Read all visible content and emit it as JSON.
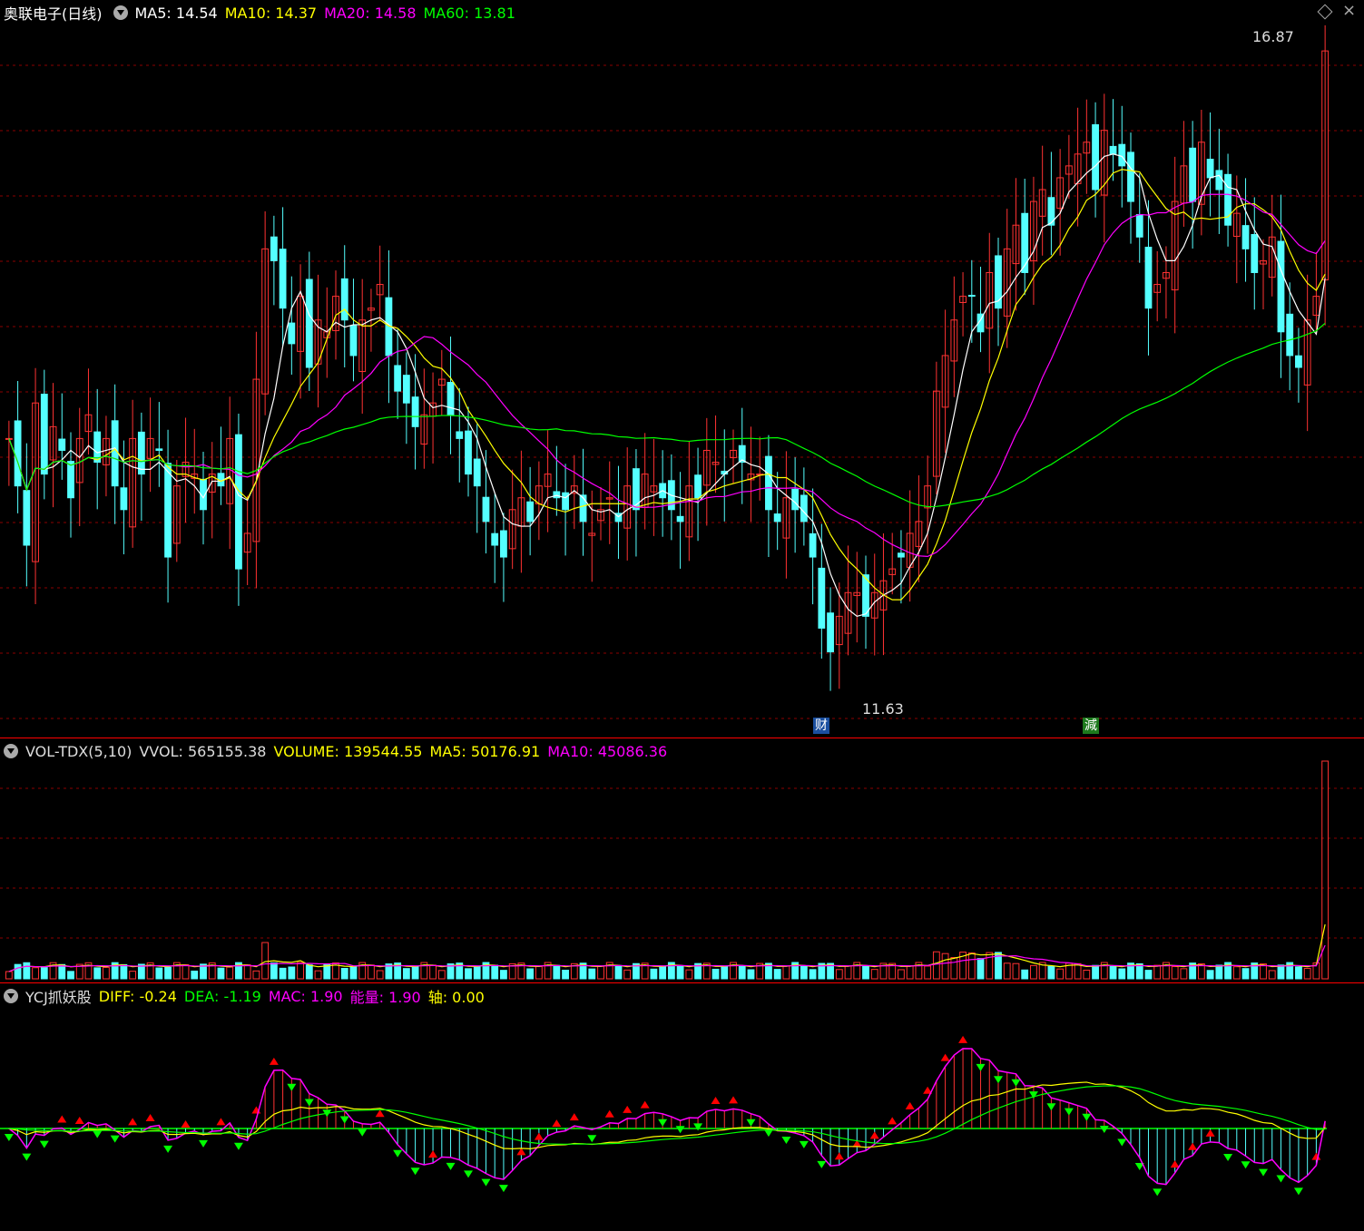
{
  "colors": {
    "up": "#ff3232",
    "down": "#54ffff",
    "ma5": "#ffffff",
    "ma10": "#ffff00",
    "ma20": "#ff00ff",
    "ma60": "#00ff00",
    "grid": "#8b0000",
    "axis": "#ff0000"
  },
  "price_panel": {
    "title": "奥联电子(日线)",
    "ma5": "MA5: 14.54",
    "ma10": "MA10: 14.37",
    "ma20": "MA20: 14.58",
    "ma60": "MA60: 13.81",
    "high_label": "16.87",
    "low_label": "11.63",
    "badge1": "财",
    "badge2": "減"
  },
  "vol_panel": {
    "name": "VOL-TDX(5,10)",
    "vvol": "VVOL: 565155.38",
    "volume": "VOLUME: 139544.55",
    "ma5": "MA5: 50176.91",
    "ma10": "MA10: 45086.36"
  },
  "ind_panel": {
    "name": "YCJ抓妖股",
    "diff": "DIFF: -0.24",
    "dea": "DEA: -1.19",
    "mac": "MAC: 1.90",
    "energy": "能量: 1.90",
    "axis": "轴: 0.00"
  },
  "chart_data": [
    {
      "type": "candlestick",
      "title": "奥联电子(日线)",
      "y_low": 11.63,
      "y_high": 16.87,
      "closes": [
        13.6,
        13.2,
        12.7,
        13.9,
        13.3,
        13.7,
        13.5,
        13.1,
        13.6,
        13.8,
        13.4,
        13.6,
        13.2,
        13.0,
        13.6,
        13.3,
        13.6,
        13.5,
        12.6,
        13.2,
        13.4,
        13.3,
        13.0,
        13.3,
        13.2,
        13.6,
        12.5,
        12.8,
        14.1,
        15.2,
        15.1,
        14.7,
        14.4,
        14.8,
        14.2,
        14.6,
        14.5,
        14.8,
        14.6,
        14.3,
        14.6,
        14.7,
        14.9,
        14.3,
        14.0,
        13.9,
        13.7,
        13.8,
        13.9,
        14.1,
        13.8,
        13.6,
        13.3,
        13.2,
        12.9,
        12.7,
        12.6,
        13.0,
        13.1,
        12.9,
        13.2,
        13.3,
        13.1,
        13.0,
        13.2,
        12.9,
        12.8,
        13.0,
        13.1,
        12.9,
        13.2,
        13.0,
        13.3,
        13.2,
        13.1,
        13.0,
        12.9,
        13.2,
        13.1,
        13.5,
        13.4,
        13.3,
        13.5,
        13.4,
        13.3,
        13.3,
        13.0,
        12.9,
        13.1,
        13.0,
        12.9,
        12.6,
        12.0,
        11.8,
        12.1,
        12.3,
        12.3,
        12.1,
        12.3,
        12.4,
        12.5,
        12.6,
        12.8,
        12.9,
        13.2,
        14.0,
        14.3,
        14.6,
        14.8,
        14.8,
        14.5,
        15.0,
        14.7,
        15.2,
        15.4,
        15.0,
        15.6,
        15.7,
        15.4,
        15.8,
        15.9,
        16.0,
        16.1,
        15.7,
        16.2,
        16.0,
        15.9,
        15.6,
        15.3,
        14.7,
        14.9,
        15.0,
        15.6,
        15.9,
        15.6,
        16.1,
        15.8,
        15.7,
        15.4,
        15.5,
        15.2,
        15.0,
        15.1,
        15.3,
        14.5,
        14.3,
        14.2,
        14.6,
        14.8,
        16.87
      ]
    },
    {
      "type": "bar",
      "title": "VOL-TDX(5,10)",
      "series": [
        {
          "name": "VOLUME",
          "last": 139544.55
        },
        {
          "name": "MA5",
          "last": 50176.91
        },
        {
          "name": "MA10",
          "last": 45086.36
        }
      ]
    },
    {
      "type": "bar",
      "title": "YCJ抓妖股",
      "series": [
        {
          "name": "DIFF",
          "last": -0.24
        },
        {
          "name": "DEA",
          "last": -1.19
        },
        {
          "name": "MAC",
          "last": 1.9
        }
      ]
    }
  ]
}
